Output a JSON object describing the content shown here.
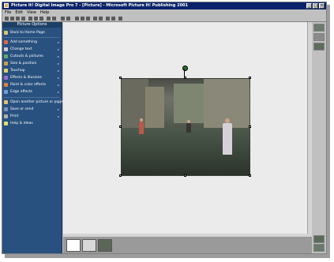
{
  "window": {
    "title": "Picture It! Digital Image Pro 7 - [Picture] - Microsoft Picture It! Publishing 2001",
    "buttons": {
      "minimize": "_",
      "maximize": "□",
      "close": "×"
    }
  },
  "menubar": {
    "items": [
      {
        "label": "File"
      },
      {
        "label": "Edit"
      },
      {
        "label": "View"
      },
      {
        "label": "Help"
      }
    ]
  },
  "sidebar": {
    "header": "Picture Options",
    "items": [
      {
        "label": "Back to Home Page",
        "icon": "home-icon",
        "arrow": ""
      },
      {
        "label": "Add something",
        "icon": "add-icon",
        "arrow": "▸"
      },
      {
        "label": "Change text",
        "icon": "text-icon",
        "arrow": "▸"
      },
      {
        "label": "Cutouts & pictures",
        "icon": "cutout-icon",
        "arrow": "▸"
      },
      {
        "label": "Size & position",
        "icon": "resize-icon",
        "arrow": "▸"
      },
      {
        "label": "Touchup",
        "icon": "touchup-icon",
        "arrow": "▸"
      },
      {
        "label": "Effects & Illusions",
        "icon": "effects-icon",
        "arrow": "▸"
      },
      {
        "label": "Paint & color effects",
        "icon": "paint-icon",
        "arrow": "▸"
      },
      {
        "label": "Edge effects",
        "icon": "edge-icon",
        "arrow": "▸"
      },
      {
        "label": "Open another picture or project",
        "icon": "open-icon",
        "arrow": "▸"
      },
      {
        "label": "Save or send",
        "icon": "save-icon",
        "arrow": "▸"
      },
      {
        "label": "Print",
        "icon": "print-icon",
        "arrow": "▸"
      },
      {
        "label": "Help & Ideas",
        "icon": "help-icon",
        "arrow": ""
      }
    ]
  },
  "colors": {
    "sidebar_bg": "#28517f",
    "titlebar_bg": "#0a246a",
    "canvas_bg": "#ebebeb"
  }
}
